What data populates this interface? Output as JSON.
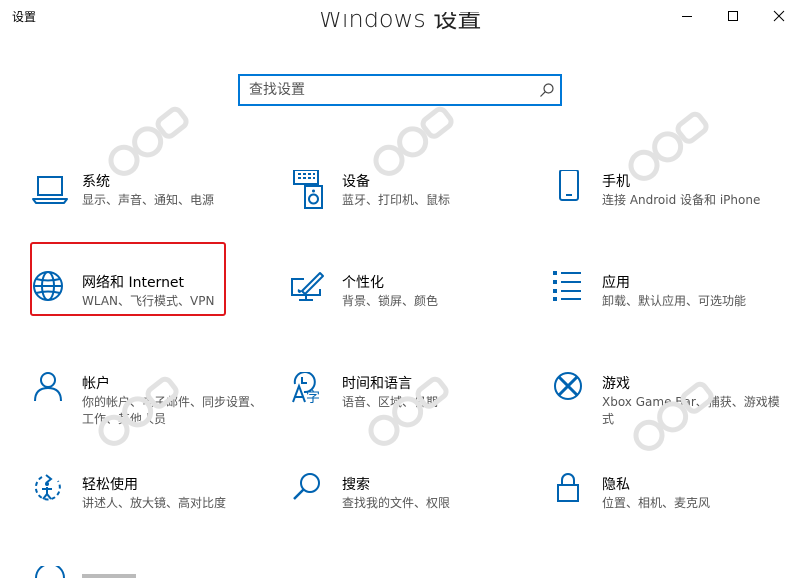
{
  "window": {
    "title": "设置",
    "heading": "Windows 设置"
  },
  "search": {
    "placeholder": "查找设置"
  },
  "colors": {
    "accent": "#0078d7",
    "highlight": "#e0161b"
  },
  "tiles": [
    {
      "title": "系统",
      "desc": "显示、声音、通知、电源",
      "icon": "laptop-icon"
    },
    {
      "title": "设备",
      "desc": "蓝牙、打印机、鼠标",
      "icon": "devices-icon"
    },
    {
      "title": "手机",
      "desc": "连接 Android 设备和 iPhone",
      "icon": "phone-icon"
    },
    {
      "title": "网络和 Internet",
      "desc": "WLAN、飞行模式、VPN",
      "icon": "globe-icon",
      "highlighted": true
    },
    {
      "title": "个性化",
      "desc": "背景、锁屏、颜色",
      "icon": "personalization-icon"
    },
    {
      "title": "应用",
      "desc": "卸载、默认应用、可选功能",
      "icon": "apps-list-icon"
    },
    {
      "title": "帐户",
      "desc": "你的帐户、电子邮件、同步设置、工作、其他人员",
      "icon": "person-icon"
    },
    {
      "title": "时间和语言",
      "desc": "语音、区域、日期",
      "icon": "time-language-icon"
    },
    {
      "title": "游戏",
      "desc": "Xbox Game Bar、捕获、游戏模式",
      "icon": "xbox-icon"
    },
    {
      "title": "轻松使用",
      "desc": "讲述人、放大镜、高对比度",
      "icon": "ease-of-access-icon"
    },
    {
      "title": "搜索",
      "desc": "查找我的文件、权限",
      "icon": "search-icon"
    },
    {
      "title": "隐私",
      "desc": "位置、相机、麦克风",
      "icon": "lock-icon"
    }
  ]
}
